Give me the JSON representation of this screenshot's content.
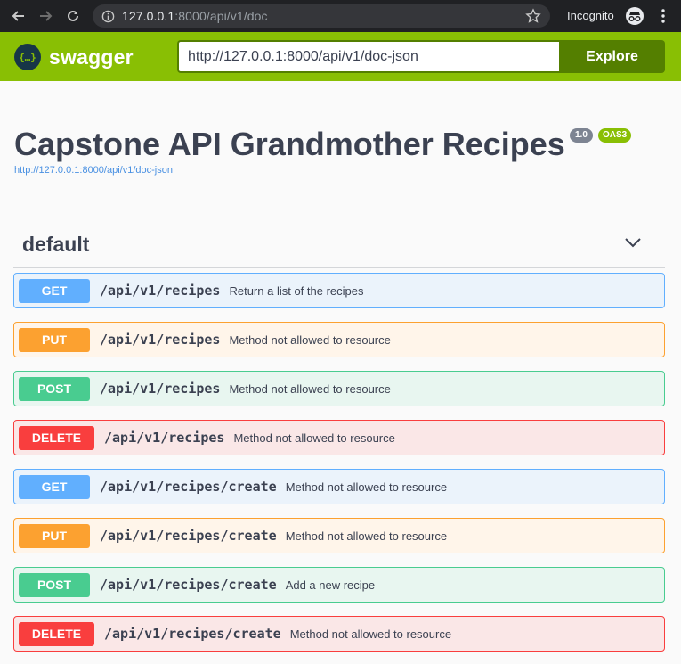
{
  "browser": {
    "url_host": "127.0.0.1",
    "url_rest": ":8000/api/v1/doc",
    "incognito_label": "Incognito"
  },
  "topbar": {
    "logo_text": "swagger",
    "spec_url_value": "http://127.0.0.1:8000/api/v1/doc-json",
    "explore_label": "Explore",
    "accent_color": "#89bf04"
  },
  "info": {
    "title": "Capstone API Grandmother Recipes",
    "version": "1.0",
    "oas_badge": "OAS3",
    "spec_link": "http://127.0.0.1:8000/api/v1/doc-json"
  },
  "tag": {
    "name": "default",
    "expanded": true
  },
  "operations": [
    {
      "method": "GET",
      "path": "/api/v1/recipes",
      "summary": "Return a list of the recipes"
    },
    {
      "method": "PUT",
      "path": "/api/v1/recipes",
      "summary": "Method not allowed to resource"
    },
    {
      "method": "POST",
      "path": "/api/v1/recipes",
      "summary": "Method not allowed to resource"
    },
    {
      "method": "DELETE",
      "path": "/api/v1/recipes",
      "summary": "Method not allowed to resource"
    },
    {
      "method": "GET",
      "path": "/api/v1/recipes/create",
      "summary": "Method not allowed to resource"
    },
    {
      "method": "PUT",
      "path": "/api/v1/recipes/create",
      "summary": "Method not allowed to resource"
    },
    {
      "method": "POST",
      "path": "/api/v1/recipes/create",
      "summary": "Add a new recipe"
    },
    {
      "method": "DELETE",
      "path": "/api/v1/recipes/create",
      "summary": "Method not allowed to resource"
    }
  ],
  "method_colors": {
    "GET": "#61affe",
    "PUT": "#fca130",
    "POST": "#49cc90",
    "DELETE": "#f93e3e"
  }
}
